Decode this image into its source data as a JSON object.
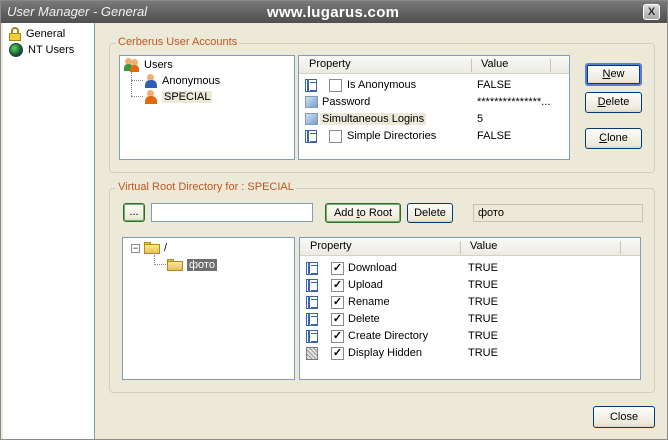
{
  "window": {
    "title": "User Manager - General",
    "watermark": "www.lugarus.com",
    "close_glyph": "X"
  },
  "sidebar": {
    "items": [
      {
        "label": "General",
        "icon": "lock-icon"
      },
      {
        "label": "NT Users",
        "icon": "globe-icon"
      }
    ]
  },
  "accounts": {
    "group_label": "Cerberus User Accounts",
    "tree": {
      "root": "Users",
      "children": [
        "Anonymous",
        "SPECIAL"
      ],
      "selected": "SPECIAL"
    },
    "grid": {
      "columns": [
        "Property",
        "Value"
      ],
      "rows": [
        {
          "icon": "list-icon",
          "checkbox": true,
          "checked": false,
          "property": "Is Anonymous",
          "value": "FALSE"
        },
        {
          "icon": "edit-icon",
          "checkbox": false,
          "property": "Password",
          "value": "***************..."
        },
        {
          "icon": "edit-icon",
          "checkbox": false,
          "property": "Simultaneous Logins",
          "value": "5"
        },
        {
          "icon": "list-icon",
          "checkbox": true,
          "checked": false,
          "property": "Simple Directories",
          "value": "FALSE"
        }
      ]
    },
    "buttons": {
      "new": {
        "u": "N",
        "rest": "ew"
      },
      "delete": {
        "u": "D",
        "rest": "elete"
      },
      "clone": {
        "u": "C",
        "rest": "lone"
      }
    }
  },
  "vroot": {
    "group_label": "Virtual Root Directory for : SPECIAL",
    "browse_label": "...",
    "path_value": "",
    "add_to_root": {
      "pre": "Add ",
      "u": "t",
      "post": "o Root"
    },
    "delete_label": "Delete",
    "selected_dir": "фото",
    "tree": {
      "root": "/",
      "children": [
        "фото"
      ]
    },
    "grid": {
      "columns": [
        "Property",
        "Value"
      ],
      "rows": [
        {
          "icon": "list-icon",
          "checked": true,
          "property": "Download",
          "value": "TRUE"
        },
        {
          "icon": "list-icon",
          "checked": true,
          "property": "Upload",
          "value": "TRUE"
        },
        {
          "icon": "list-icon",
          "checked": true,
          "property": "Rename",
          "value": "TRUE"
        },
        {
          "icon": "list-icon",
          "checked": true,
          "property": "Delete",
          "value": "TRUE"
        },
        {
          "icon": "list-icon",
          "checked": true,
          "property": "Create Directory",
          "value": "TRUE"
        },
        {
          "icon": "shaded-icon",
          "checked": true,
          "property": "Display Hidden",
          "value": "TRUE"
        }
      ]
    }
  },
  "footer": {
    "close_label": "Close"
  },
  "colors": {
    "group_label": "#c2561e",
    "border": "#7f9db9",
    "face": "#ece9d8"
  }
}
